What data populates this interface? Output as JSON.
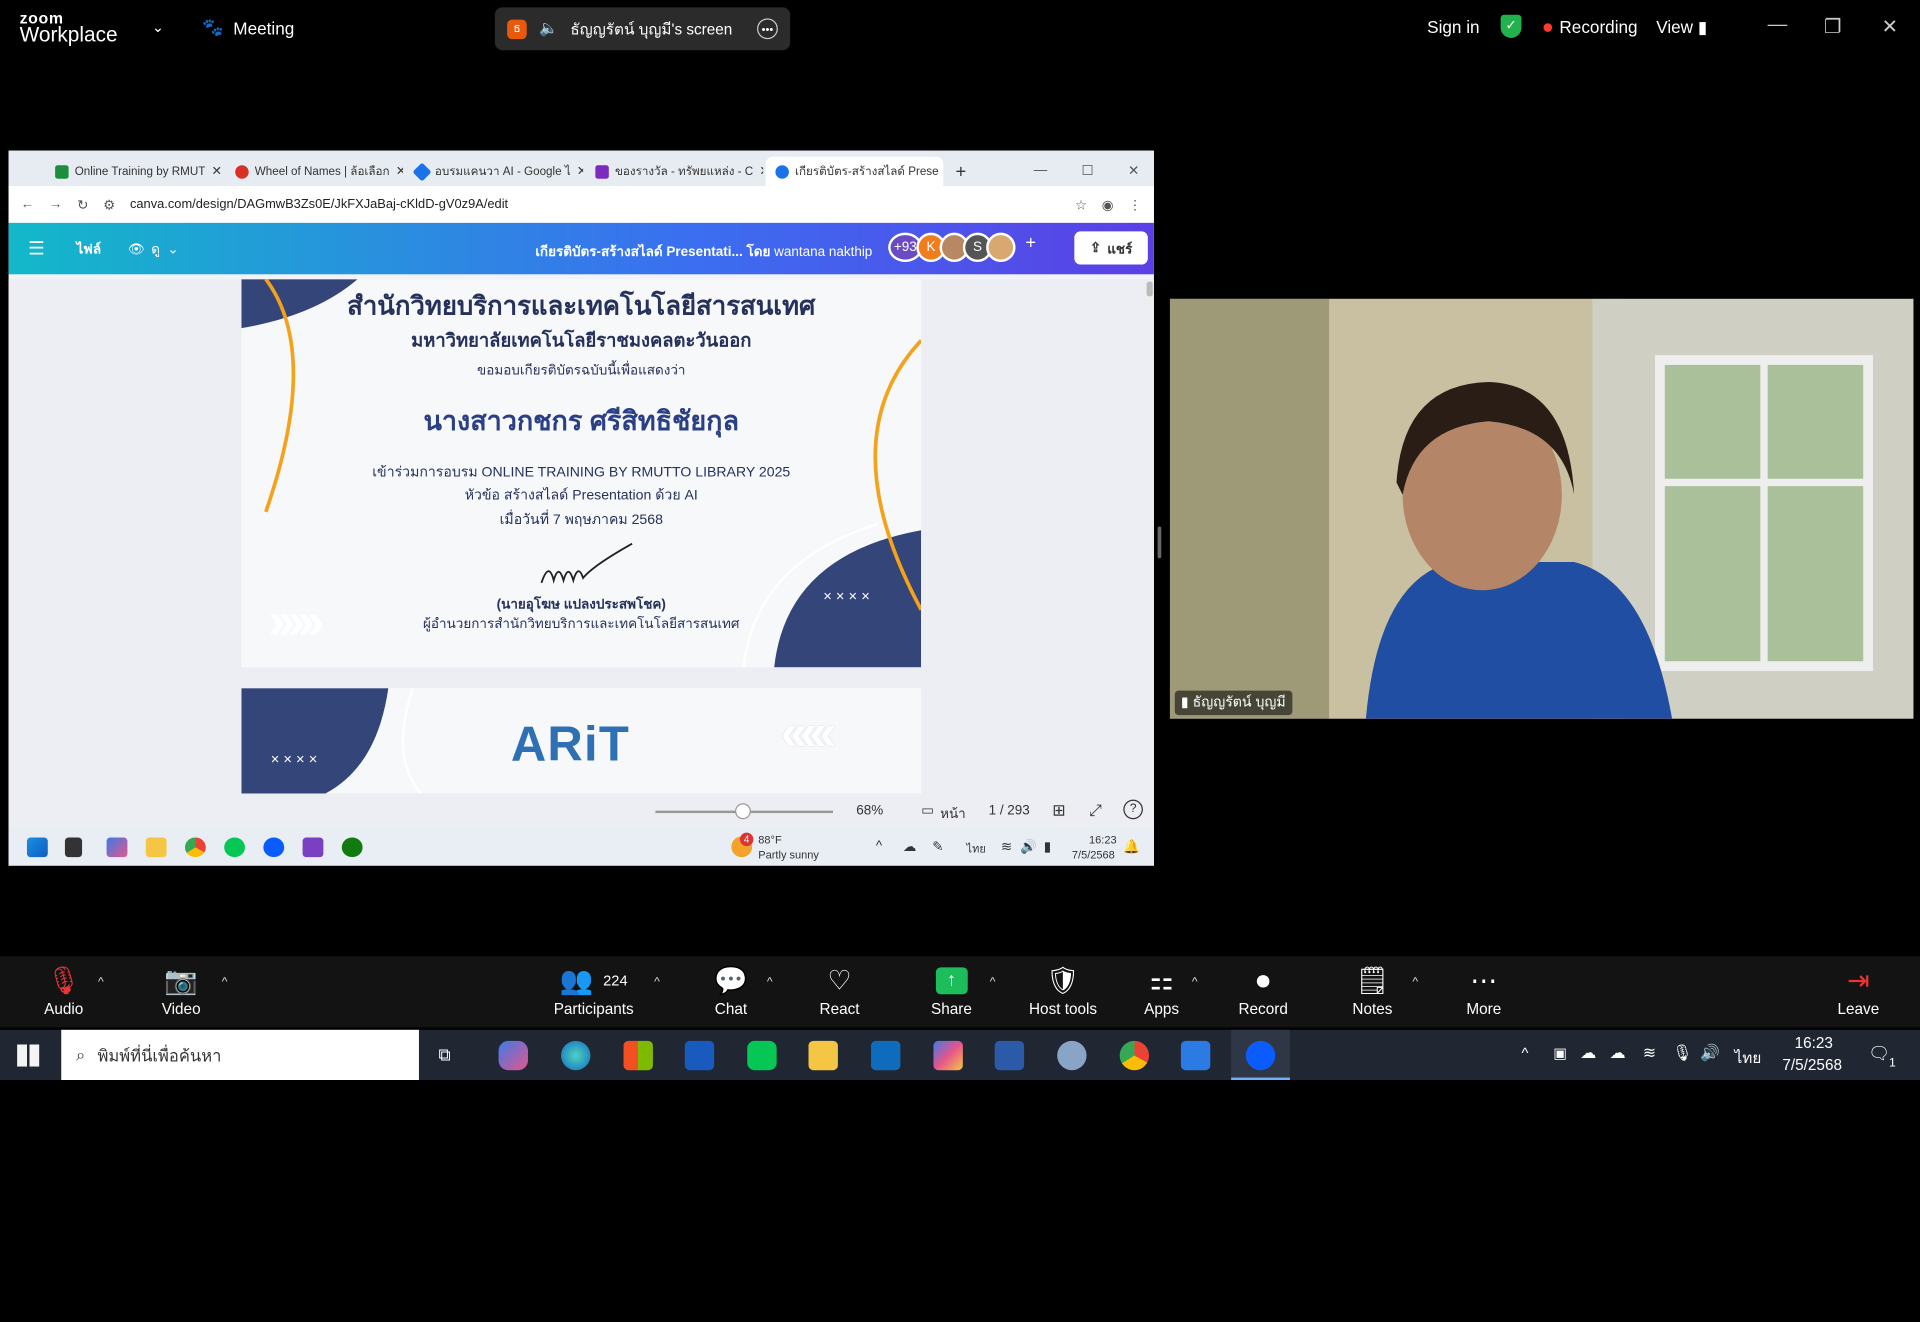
{
  "zoom": {
    "logo_top": "zoom",
    "logo_bottom": "Workplace",
    "meeting": "Meeting",
    "screen_badge": "ธ",
    "screen_label": "ธัญญรัตน์ บุญมี's screen",
    "sign_in": "Sign in",
    "recording": "Recording",
    "view": "View"
  },
  "browser": {
    "tabs": [
      {
        "label": "Online Training by RMUT",
        "color": "#1e8e3e"
      },
      {
        "label": "Wheel of Names | ล้อเลือก",
        "color": "#d93025"
      },
      {
        "label": "อบรมแคนวา AI - Google ไ",
        "color": "#1a73e8"
      },
      {
        "label": "ของรางวัล - ทรัพยแหล่ง - C",
        "color": "#7b2cbf"
      },
      {
        "label": "เกียรติบัตร-สร้างสไลด์ Prese",
        "color": "#1a73e8"
      }
    ],
    "new_tab": "+",
    "url": "canva.com/design/DAGmwB3Zs0E/JkFXJaBaj-cKldD-gV0z9A/edit"
  },
  "canva": {
    "file": "ไฟล์",
    "view": "ดู",
    "title": "เกียรติบัตร-สร้างสไลด์ Presentati...",
    "by": "โดย",
    "author": "wantana nakthip",
    "count": "+93",
    "avatars": [
      "K",
      "",
      "S",
      ""
    ],
    "share": "แชร์",
    "zoom": "68%",
    "pages_label": "หน้า",
    "page": "1 / 293"
  },
  "certificate": {
    "org": "สำนักวิทยบริการและเทคโนโลยีสารสนเทศ",
    "university": "มหาวิทยาลัยเทคโนโลยีราชมงคลตะวันออก",
    "intro": "ขอมอบเกียรติบัตรฉบับนี้เพื่อแสดงว่า",
    "name": "นางสาวกชกร ศรีสิทธิชัยกุล",
    "line1": "เข้าร่วมการอบรม ONLINE TRAINING BY RMUTTO LIBRARY 2025",
    "line2": "หัวข้อ สร้างสไลด์ Presentation ด้วย AI",
    "line3": "เมื่อวันที่ 7 พฤษภาคม 2568",
    "signer": "(นายอุโฆษ แปลงประสพโชค)",
    "signer_title": "ผู้อำนวยการสำนักวิทยบริการและเทคโนโลยีสารสนเทศ",
    "arrows": "›››››",
    "crosses": "× × × ×",
    "logo2": "ARiT",
    "arrows2": "‹‹‹‹‹"
  },
  "win_inner": {
    "weather_temp": "88°F",
    "weather_desc": "Partly sunny",
    "weather_badge": "4",
    "lang": "ไทย",
    "time": "16:23",
    "date": "7/5/2568"
  },
  "video": {
    "name": "ธัญญรัตน์ บุญมี"
  },
  "toolbar": {
    "audio": "Audio",
    "video": "Video",
    "participants": "Participants",
    "participants_count": "224",
    "chat": "Chat",
    "react": "React",
    "share": "Share",
    "host_tools": "Host tools",
    "apps": "Apps",
    "record": "Record",
    "notes": "Notes",
    "more": "More",
    "leave": "Leave"
  },
  "taskbar": {
    "search_placeholder": "พิมพ์ที่นี่เพื่อค้นหา",
    "lang": "ไทย",
    "time": "16:23",
    "date": "7/5/2568",
    "notif": "1"
  }
}
